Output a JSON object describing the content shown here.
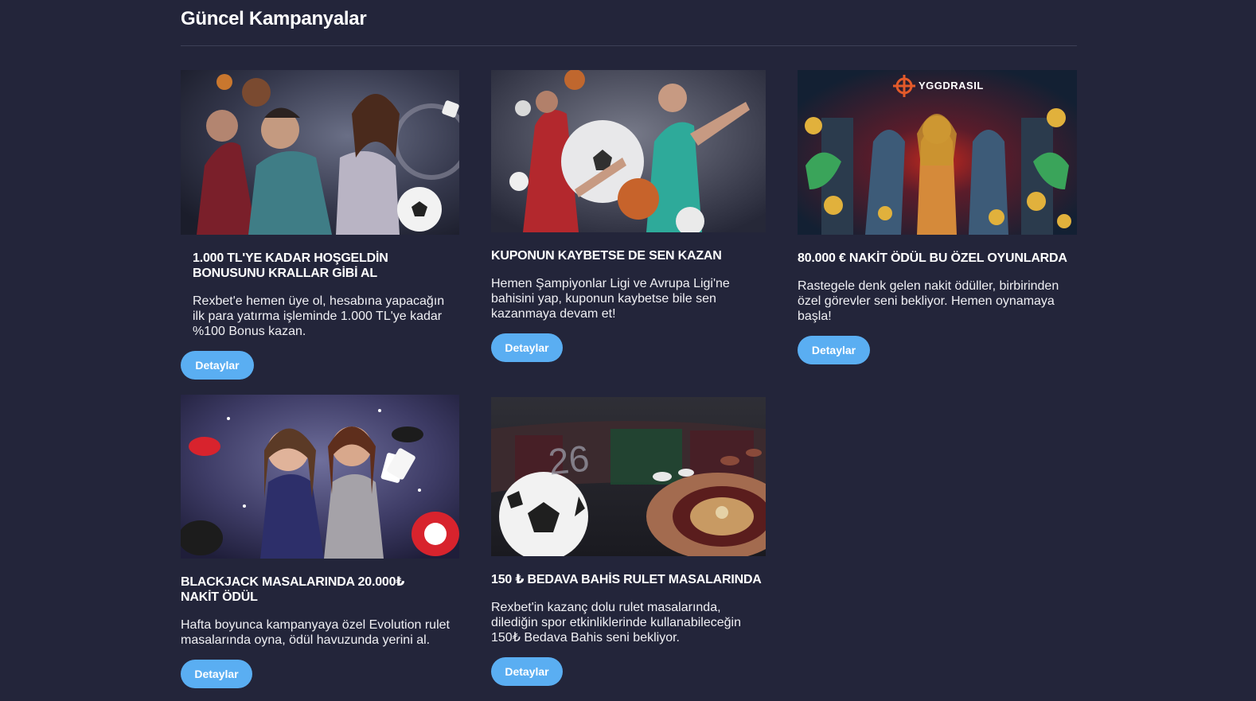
{
  "section": {
    "title": "Güncel Kampanyalar"
  },
  "colors": {
    "background": "#23253a",
    "button": "#5aaef2",
    "divider": "#3d4056"
  },
  "cards": [
    {
      "image": "sports-casino-welcome-banner",
      "title": "1.000 TL'YE KADAR HOŞGELDİN BONUSUNU KRALLAR GİBİ AL",
      "description": "Rexbet'e hemen üye ol, hesabına yapacağın ilk para yatırma işleminde 1.000 TL'ye kadar %100 Bonus kazan.",
      "button": "Detaylar"
    },
    {
      "image": "sports-players-banner",
      "title": "KUPONUN KAYBETSE DE SEN KAZAN",
      "description": "Hemen Şampiyonlar Ligi ve Avrupa Ligi'ne bahisini yap, kuponun kaybetse bile sen kazanmaya devam et!",
      "button": "Detaylar"
    },
    {
      "image": "yggdrasil-egyptian-banner",
      "image_text": "YGGDRASIL",
      "title": "80.000 € NAKİT ÖDÜL BU ÖZEL OYUNLARDA",
      "description": "Rastegele denk gelen nakit ödüller, birbirinden özel görevler seni bekliyor. Hemen oynamaya başla!",
      "button": "Detaylar"
    },
    {
      "image": "blackjack-dealers-banner",
      "title": "BLACKJACK MASALARINDA 20.000₺ NAKİT ÖDÜL",
      "description": "Hafta boyunca kampanyaya özel Evolution rulet masalarında oyna, ödül havuzunda yerini al.",
      "button": "Detaylar"
    },
    {
      "image": "roulette-football-banner",
      "image_text": "26",
      "title": "150 ₺ BEDAVA BAHİS RULET MASALARINDA",
      "description": "Rexbet'in kazanç dolu rulet masalarında, dilediğin spor etkinliklerinde kullanabileceğin 150₺ Bedava Bahis seni bekliyor.",
      "button": "Detaylar"
    }
  ]
}
